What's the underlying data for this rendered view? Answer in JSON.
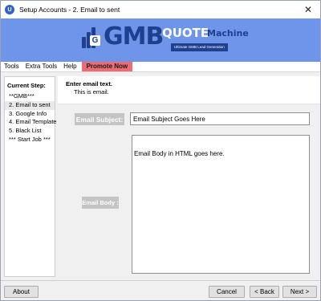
{
  "window": {
    "title": "Setup Accounts - 2. Email to sent",
    "app_icon": "U",
    "close_glyph": "✕"
  },
  "banner": {
    "logo_gmb": "GMB",
    "logo_quote": "QUOTE",
    "logo_machine": "Machine",
    "logo_g": "G",
    "tagline": "Ultimate GMB Lead Generation",
    "color": "#6f95ea"
  },
  "menu": {
    "items": [
      "Tools",
      "Extra Tools",
      "Help"
    ],
    "promote": "Promote Now",
    "promote_color": "#ec6c74"
  },
  "steps": {
    "title": "Current Step:",
    "items": [
      "**GMB***",
      "2. Email to sent",
      "3. Google Info",
      "4. Email Template",
      "5. Black List",
      "*** Start Job ***"
    ],
    "active_index": 1
  },
  "info": {
    "title": "Enter email text.",
    "subtitle": "This is email."
  },
  "form": {
    "subject_label": "Email Subject:",
    "subject_value": "Email Subject Goes Here",
    "body_label": "Email Body :",
    "body_value": "Email Body in HTML goes here."
  },
  "buttons": {
    "about": "About",
    "cancel": "Cancel",
    "back": "< Back",
    "next": "Next >"
  }
}
